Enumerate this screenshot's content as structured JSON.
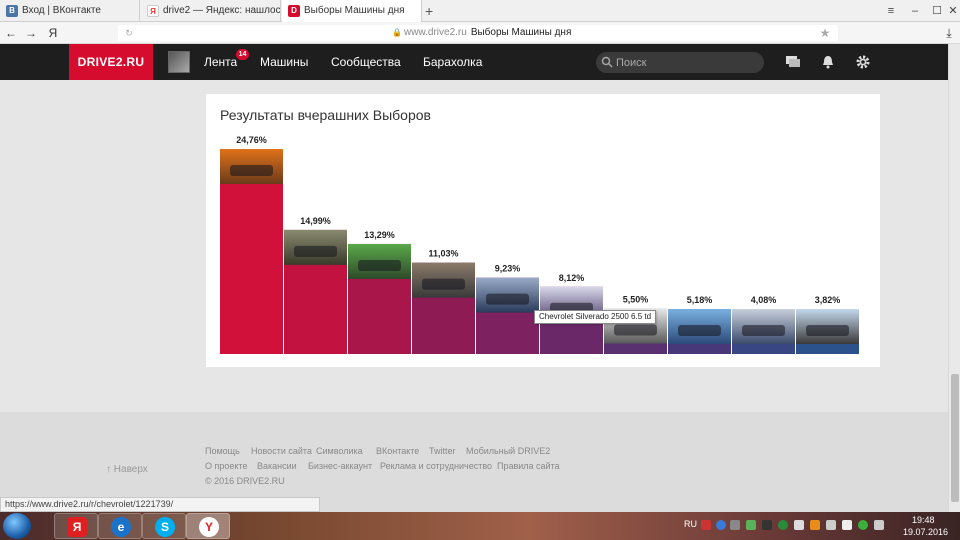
{
  "browser": {
    "tabs": [
      {
        "label": "Вход | ВКонтакте",
        "icon": "vk-icon"
      },
      {
        "label": "drive2 — Яндекс: нашлось",
        "icon": "yandex-icon"
      },
      {
        "label": "Выборы Машины дня",
        "icon": "drive2-icon"
      }
    ],
    "new_tab": "+",
    "url_host": "www.drive2.ru",
    "url_title": "Выборы Машины дня",
    "yandex_glyph": "Я"
  },
  "header": {
    "logo": "DRIVE2.RU",
    "nav": [
      {
        "label": "Лента"
      },
      {
        "label": "Машины"
      },
      {
        "label": "Сообщества"
      },
      {
        "label": "Барахолка"
      }
    ],
    "feed_badge": "14",
    "search_placeholder": "Поиск"
  },
  "card": {
    "title": "Результаты вчерашних Выборов"
  },
  "chart_data": {
    "type": "bar",
    "values": [
      24.76,
      14.99,
      13.29,
      11.03,
      9.23,
      8.12,
      5.5,
      5.18,
      4.08,
      3.82
    ],
    "labels": [
      "24,76%",
      "14,99%",
      "13,29%",
      "11,03%",
      "9,23%",
      "8,12%",
      "5,50%",
      "5,18%",
      "4,08%",
      "3,82%"
    ],
    "colors": [
      "#d2113a",
      "#c11240",
      "#a8164a",
      "#8f1b55",
      "#7d2160",
      "#6b2868",
      "#593070",
      "#47387a",
      "#384683",
      "#2b528b"
    ]
  },
  "tooltip": "Chevrolet Silverado 2500 6.5 td",
  "footer": {
    "up": "Наверх",
    "row1": [
      "Помощь",
      "Новости сайта",
      "Символика",
      "ВКонтакте",
      "Twitter",
      "Мобильный DRIVE2"
    ],
    "row2": [
      "О проекте",
      "Вакансии",
      "Бизнес-аккаунт",
      "Реклама и сотрудничество",
      "Правила сайта"
    ],
    "copyright": "© 2016 DRIVE2.RU"
  },
  "status_url": "https://www.drive2.ru/r/chevrolet/1221739/",
  "taskbar": {
    "lang": "RU",
    "time": "19:48",
    "date": "19.07.2016"
  }
}
